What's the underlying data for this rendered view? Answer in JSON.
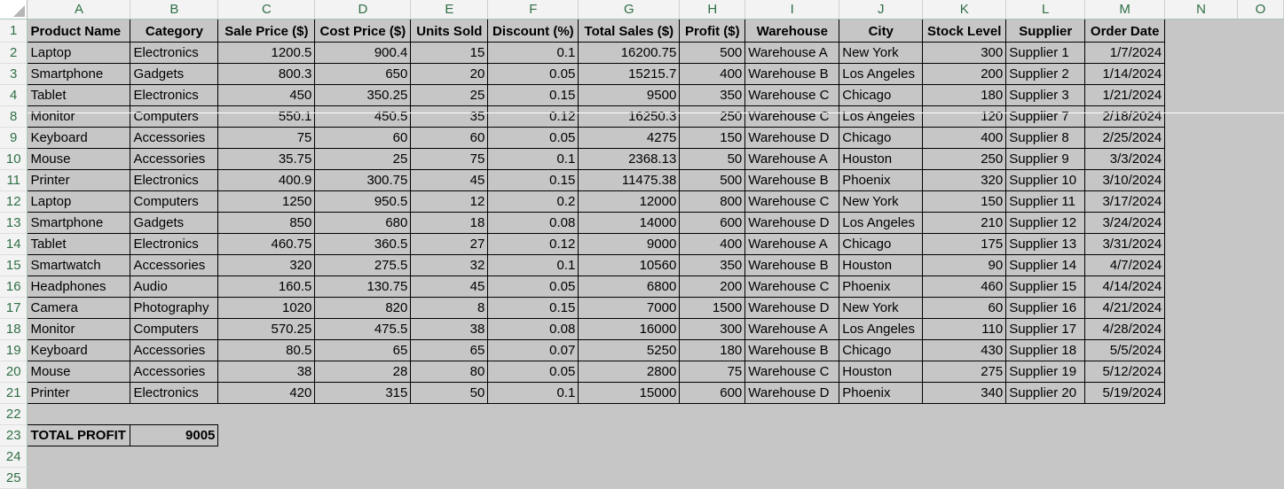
{
  "columns": [
    "A",
    "B",
    "C",
    "D",
    "E",
    "F",
    "G",
    "H",
    "I",
    "J",
    "K",
    "L",
    "M",
    "N",
    "O"
  ],
  "headers": [
    "Product Name",
    "Category",
    "Sale Price ($)",
    "Cost Price ($)",
    "Units Sold",
    "Discount (%)",
    "Total Sales ($)",
    "Profit ($)",
    "Warehouse",
    "City",
    "Stock Level",
    "Supplier",
    "Order Date"
  ],
  "rows": [
    {
      "num": "2",
      "cells": [
        "Laptop",
        "Electronics",
        "1200.5",
        "900.4",
        "15",
        "0.1",
        "16200.75",
        "500",
        "Warehouse A",
        "New York",
        "300",
        "Supplier 1",
        "1/7/2024"
      ]
    },
    {
      "num": "3",
      "cells": [
        "Smartphone",
        "Gadgets",
        "800.3",
        "650",
        "20",
        "0.05",
        "15215.7",
        "400",
        "Warehouse B",
        "Los Angeles",
        "200",
        "Supplier 2",
        "1/14/2024"
      ]
    },
    {
      "num": "4",
      "cells": [
        "Tablet",
        "Electronics",
        "450",
        "350.25",
        "25",
        "0.15",
        "9500",
        "350",
        "Warehouse C",
        "Chicago",
        "180",
        "Supplier 3",
        "1/21/2024"
      ]
    },
    {
      "num": "8",
      "cells": [
        "Monitor",
        "Computers",
        "550.1",
        "450.5",
        "35",
        "0.12",
        "16250.3",
        "250",
        "Warehouse C",
        "Los Angeles",
        "120",
        "Supplier 7",
        "2/18/2024"
      ]
    },
    {
      "num": "9",
      "cells": [
        "Keyboard",
        "Accessories",
        "75",
        "60",
        "60",
        "0.05",
        "4275",
        "150",
        "Warehouse D",
        "Chicago",
        "400",
        "Supplier 8",
        "2/25/2024"
      ]
    },
    {
      "num": "10",
      "cells": [
        "Mouse",
        "Accessories",
        "35.75",
        "25",
        "75",
        "0.1",
        "2368.13",
        "50",
        "Warehouse A",
        "Houston",
        "250",
        "Supplier 9",
        "3/3/2024"
      ]
    },
    {
      "num": "11",
      "cells": [
        "Printer",
        "Electronics",
        "400.9",
        "300.75",
        "45",
        "0.15",
        "11475.38",
        "500",
        "Warehouse B",
        "Phoenix",
        "320",
        "Supplier 10",
        "3/10/2024"
      ]
    },
    {
      "num": "12",
      "cells": [
        "Laptop",
        "Computers",
        "1250",
        "950.5",
        "12",
        "0.2",
        "12000",
        "800",
        "Warehouse C",
        "New York",
        "150",
        "Supplier 11",
        "3/17/2024"
      ]
    },
    {
      "num": "13",
      "cells": [
        "Smartphone",
        "Gadgets",
        "850",
        "680",
        "18",
        "0.08",
        "14000",
        "600",
        "Warehouse D",
        "Los Angeles",
        "210",
        "Supplier 12",
        "3/24/2024"
      ]
    },
    {
      "num": "14",
      "cells": [
        "Tablet",
        "Electronics",
        "460.75",
        "360.5",
        "27",
        "0.12",
        "9000",
        "400",
        "Warehouse A",
        "Chicago",
        "175",
        "Supplier 13",
        "3/31/2024"
      ]
    },
    {
      "num": "15",
      "cells": [
        "Smartwatch",
        "Accessories",
        "320",
        "275.5",
        "32",
        "0.1",
        "10560",
        "350",
        "Warehouse B",
        "Houston",
        "90",
        "Supplier 14",
        "4/7/2024"
      ]
    },
    {
      "num": "16",
      "cells": [
        "Headphones",
        "Audio",
        "160.5",
        "130.75",
        "45",
        "0.05",
        "6800",
        "200",
        "Warehouse C",
        "Phoenix",
        "460",
        "Supplier 15",
        "4/14/2024"
      ]
    },
    {
      "num": "17",
      "cells": [
        "Camera",
        "Photography",
        "1020",
        "820",
        "8",
        "0.15",
        "7000",
        "1500",
        "Warehouse D",
        "New York",
        "60",
        "Supplier 16",
        "4/21/2024"
      ]
    },
    {
      "num": "18",
      "cells": [
        "Monitor",
        "Computers",
        "570.25",
        "475.5",
        "38",
        "0.08",
        "16000",
        "300",
        "Warehouse A",
        "Los Angeles",
        "110",
        "Supplier 17",
        "4/28/2024"
      ]
    },
    {
      "num": "19",
      "cells": [
        "Keyboard",
        "Accessories",
        "80.5",
        "65",
        "65",
        "0.07",
        "5250",
        "180",
        "Warehouse B",
        "Chicago",
        "430",
        "Supplier 18",
        "5/5/2024"
      ]
    },
    {
      "num": "20",
      "cells": [
        "Mouse",
        "Accessories",
        "38",
        "28",
        "80",
        "0.05",
        "2800",
        "75",
        "Warehouse C",
        "Houston",
        "275",
        "Supplier 19",
        "5/12/2024"
      ]
    },
    {
      "num": "21",
      "cells": [
        "Printer",
        "Electronics",
        "420",
        "315",
        "50",
        "0.1",
        "15000",
        "600",
        "Warehouse D",
        "Phoenix",
        "340",
        "Supplier 20",
        "5/19/2024"
      ]
    }
  ],
  "header_row_num": "1",
  "blank_rows": [
    "22",
    "24",
    "25"
  ],
  "total": {
    "row_num": "23",
    "label": "TOTAL PROFIT",
    "value": "9005"
  },
  "colors": {
    "grid_bg": "#c6c6c6",
    "header_bg": "#f3f3f3",
    "header_text": "#2f6f45",
    "border": "#000000"
  }
}
